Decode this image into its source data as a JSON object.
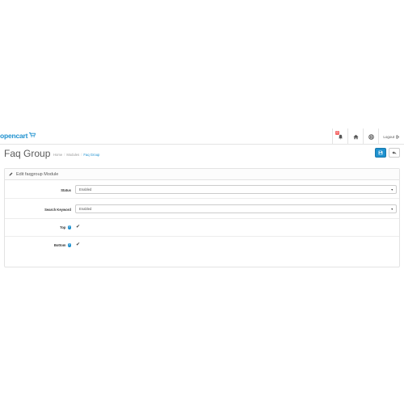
{
  "header": {
    "logo_text": "opencart",
    "logout_label": "Logout",
    "notification_count": "0",
    "icons": [
      "bell-icon",
      "home-icon",
      "life-ring-icon",
      "sign-out-icon"
    ]
  },
  "page": {
    "title": "Faq Group",
    "breadcrumb": [
      "Home",
      "Modules",
      "Faq Group"
    ]
  },
  "panel": {
    "heading": "Edit faqgroup Module"
  },
  "form": {
    "status": {
      "label": "Status",
      "value": "Enabled"
    },
    "search_keyword": {
      "label": "Search Keyword",
      "value": "Enabled"
    },
    "top": {
      "label": "Top",
      "checked": true,
      "check_glyph": "✔"
    },
    "bottom": {
      "label": "Bottom",
      "checked": true,
      "check_glyph": "✔"
    },
    "help_glyph": "?"
  },
  "colors": {
    "accent": "#1e91cf",
    "badge": "#f56b6b"
  }
}
